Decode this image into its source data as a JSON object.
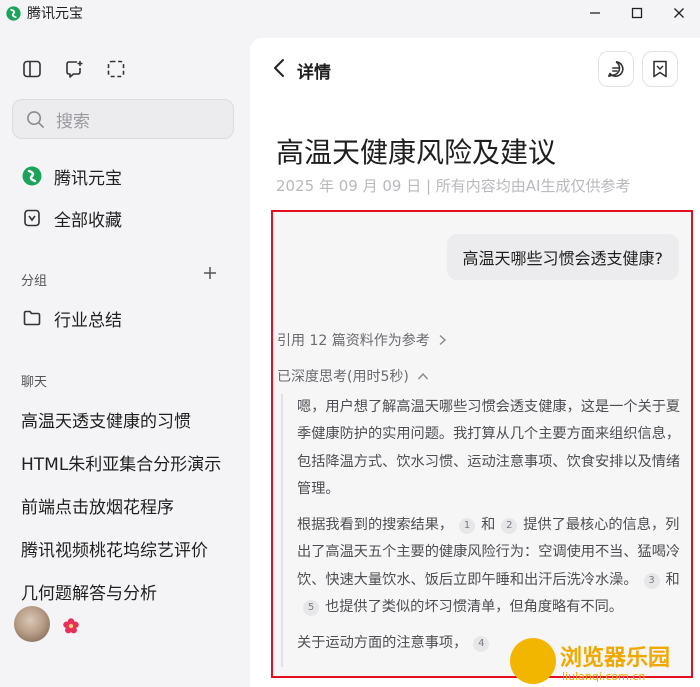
{
  "window": {
    "title": "腾讯元宝",
    "minimize_icon": "minimize-icon",
    "maximize_icon": "maximize-icon",
    "close_icon": "close-icon"
  },
  "sidebar": {
    "search_placeholder": "搜索",
    "nav": [
      {
        "label": "腾讯元宝",
        "icon": "yuanbao-logo-icon"
      },
      {
        "label": "全部收藏",
        "icon": "bookmark-icon"
      }
    ],
    "groups_header": "分组",
    "groups": [
      {
        "label": "行业总结",
        "icon": "folder-icon"
      }
    ],
    "chats_header": "聊天",
    "chats": [
      "高温天透支健康的习惯",
      "HTML朱利亚集合分形演示",
      "前端点击放烟花程序",
      "腾讯视频桃花坞综艺评价",
      "几何题解答与分析"
    ]
  },
  "main": {
    "header_title": "详情",
    "doc_title": "高温天健康风险及建议",
    "doc_meta": "2025 年 09 月 09 日 | 所有内容均由AI生成仅供参考",
    "user_question": "高温天哪些习惯会透支健康?",
    "refs_label": "引用 12 篇资料作为参考",
    "think_label": "已深度思考(用时5秒)",
    "think": {
      "p1": "嗯，用户想了解高温天哪些习惯会透支健康，这是一个关于夏季健康防护的实用问题。我打算从几个主要方面来组织信息，包括降温方式、饮水习惯、运动注意事项、饮食安排以及情绪管理。",
      "p2_a": "根据我看到的搜索结果，",
      "c1": "1",
      "p2_b": "和",
      "c2": "2",
      "p2_c": "提供了最核心的信息，列出了高温天五个主要的健康风险行为：空调使用不当、猛喝冷饮、快速大量饮水、饭后立即午睡和出汗后洗冷水澡。",
      "c3": "3",
      "p2_d": "和",
      "c5": "5",
      "p2_e": "也提供了类似的坏习惯清单，但角度略有不同。",
      "p3_a": "关于运动方面的注意事项，",
      "c4": "4"
    }
  },
  "watermark": {
    "text": "浏览器乐园",
    "sub": "liulanqi.com.cn"
  },
  "colors": {
    "highlight_border": "#e3101f",
    "brand_green": "#1aa35a",
    "flower": "#e8305a"
  }
}
